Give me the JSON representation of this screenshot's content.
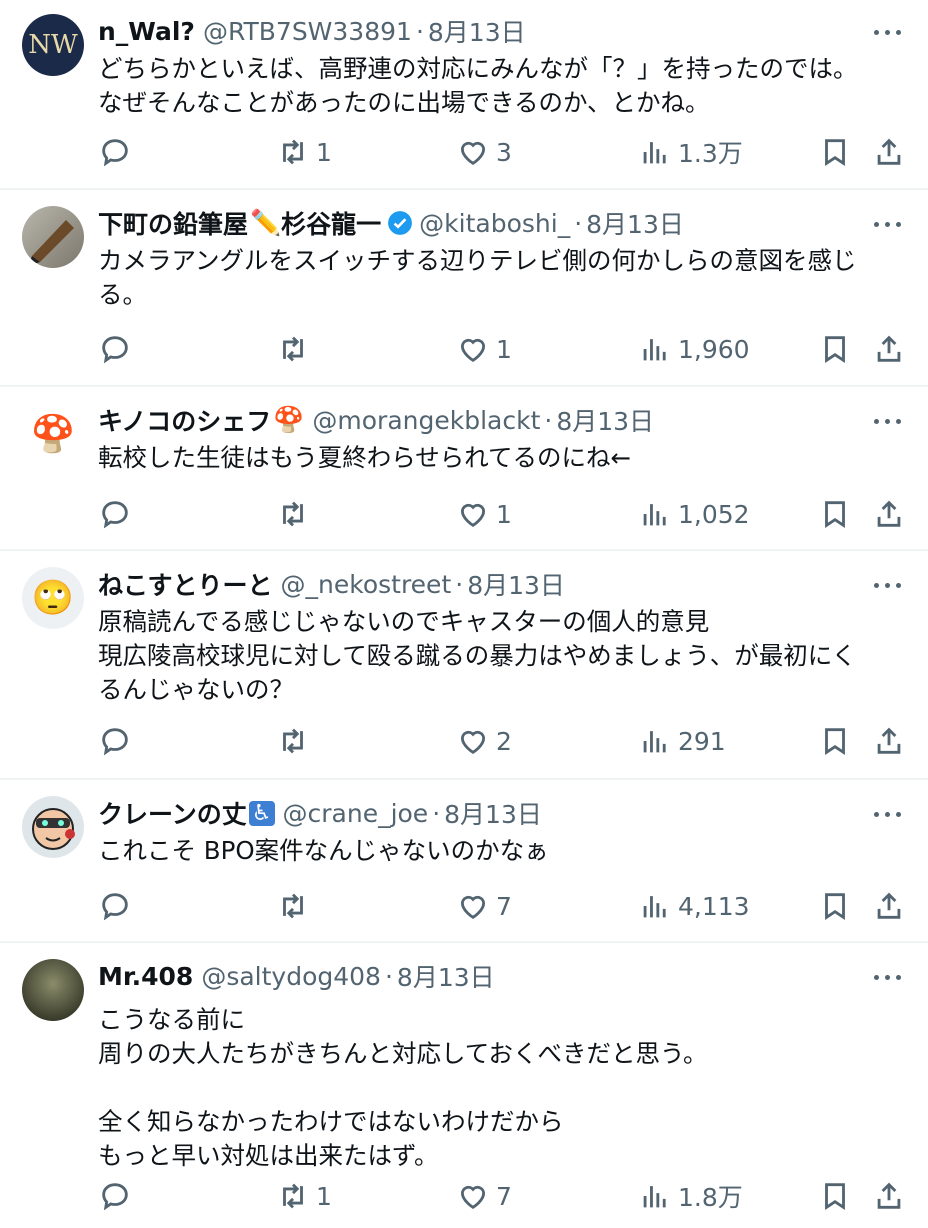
{
  "tweets": [
    {
      "name": "n_Wal?",
      "name_emoji": "",
      "verified": false,
      "handle": "@RTB7SW33891",
      "date": "8月13日",
      "lines": [
        "どちらかといえば、高野連の対応にみんなが「？」を持ったのでは。",
        "なぜそんなことがあったのに出場できるのか、とかね。"
      ],
      "replies": "",
      "retweets": "1",
      "likes": "3",
      "views": "1.3万",
      "avatar_text": "NW",
      "avatar_color": "#1c2a4a"
    },
    {
      "name": "下町の鉛筆屋",
      "name_emoji": "✏️",
      "name_suffix": "杉谷龍一",
      "verified": true,
      "handle": "@kitaboshi_",
      "date": "8月13日",
      "lines": [
        "カメラアングルをスイッチする辺りテレビ側の何かしらの意図を感じ",
        "る。"
      ],
      "replies": "",
      "retweets": "",
      "likes": "1",
      "views": "1,960",
      "avatar_text": "",
      "avatar_color": "#8a8a80"
    },
    {
      "name": "キノコのシェフ",
      "name_emoji": "🍄",
      "verified": false,
      "handle": "@morangekblackt",
      "date": "8月13日",
      "lines": [
        "転校した生徒はもう夏終わらせられてるのにね←"
      ],
      "replies": "",
      "retweets": "",
      "likes": "1",
      "views": "1,052",
      "avatar_text": "🍄",
      "avatar_color": "#ffffff"
    },
    {
      "name": "ねこすとりーと",
      "name_emoji": "",
      "verified": false,
      "handle": "@_nekostreet",
      "date": "8月13日",
      "lines": [
        "原稿読んでる感じじゃないのでキャスターの個人的意見",
        "現広陵高校球児に対して殴る蹴るの暴力はやめましょう、が最初にく",
        "るんじゃないの？"
      ],
      "replies": "",
      "retweets": "",
      "likes": "2",
      "views": "291",
      "avatar_text": "🙄",
      "avatar_color": "#eef1f4"
    },
    {
      "name": "クレーンの丈",
      "name_emoji": "♿",
      "verified": false,
      "handle": "@crane_joe",
      "date": "8月13日",
      "lines": [
        "これこそ BPO案件なんじゃないのかなぁ"
      ],
      "replies": "",
      "retweets": "",
      "likes": "7",
      "views": "4,113",
      "avatar_text": "",
      "avatar_color": "#dfe6e9"
    },
    {
      "name": "Mr.408",
      "name_emoji": "",
      "verified": false,
      "handle": "@saltydog408",
      "date": "8月13日",
      "lines": [
        "こうなる前に",
        "周りの大人たちがきちんと対応しておくべきだと思う。",
        "",
        "全く知らなかったわけではないわけだから",
        "もっと早い対処は出来たはず。"
      ],
      "replies": "",
      "retweets": "1",
      "likes": "7",
      "views": "1.8万",
      "avatar_text": "",
      "avatar_color": "#3a3d2c"
    }
  ]
}
